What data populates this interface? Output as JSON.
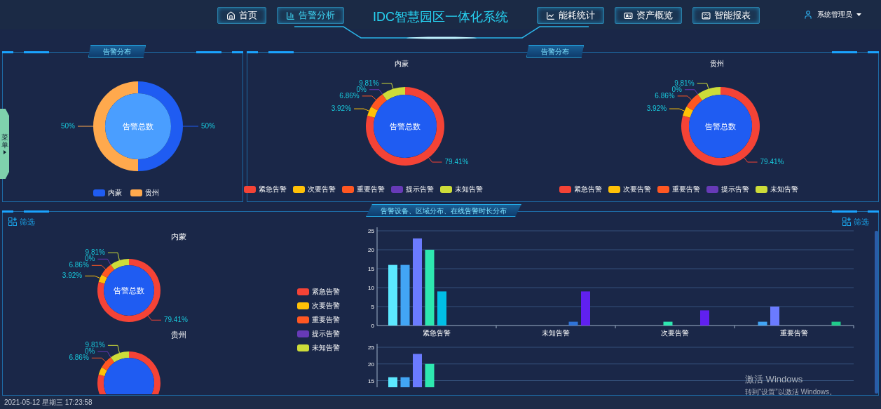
{
  "header": {
    "nav_left": [
      {
        "label": "首页",
        "selected": false
      },
      {
        "label": "告警分析",
        "selected": true
      }
    ],
    "title": "IDC智慧园区一体化系统",
    "nav_right": [
      {
        "label": "能耗统计",
        "selected": false
      },
      {
        "label": "资产概览",
        "selected": false
      },
      {
        "label": "智能报表",
        "selected": false
      }
    ],
    "user": "系统管理员"
  },
  "side_menu": {
    "label": "菜单"
  },
  "region_panel": {
    "title": "告警分布",
    "center_label": "告警总数",
    "chart_data": {
      "type": "donut",
      "values": [
        50,
        50
      ],
      "value_labels": [
        "50%",
        "50%"
      ]
    },
    "legend": [
      {
        "label": "内蒙",
        "color": "#1f5cf2"
      },
      {
        "label": "贵州",
        "color": "#ffa94d"
      }
    ]
  },
  "level_panel": {
    "title": "告警分布",
    "charts": [
      {
        "title": "内蒙",
        "center_label": "告警总数",
        "chart_data": {
          "type": "donut",
          "values": [
            79.41,
            3.92,
            6.86,
            0,
            9.81
          ],
          "value_labels": [
            "79.41%",
            "3.92%",
            "6.86%",
            "0%",
            "9.81%"
          ]
        },
        "legend": [
          {
            "label": "紧急告警",
            "color": "#f44336"
          },
          {
            "label": "次要告警",
            "color": "#ffc107"
          },
          {
            "label": "重要告警",
            "color": "#ff5722"
          },
          {
            "label": "提示告警",
            "color": "#673ab7"
          },
          {
            "label": "未知告警",
            "color": "#cddc39"
          }
        ]
      },
      {
        "title": "贵州",
        "center_label": "告警总数",
        "chart_data": {
          "type": "donut",
          "values": [
            79.41,
            3.92,
            6.86,
            0,
            9.81
          ],
          "value_labels": [
            "79.41%",
            "3.92%",
            "6.86%",
            "0%",
            "9.81%"
          ]
        },
        "legend": [
          {
            "label": "紧急告警",
            "color": "#f44336"
          },
          {
            "label": "次要告警",
            "color": "#ffc107"
          },
          {
            "label": "重要告警",
            "color": "#ff5722"
          },
          {
            "label": "提示告警",
            "color": "#673ab7"
          },
          {
            "label": "未知告警",
            "color": "#cddc39"
          }
        ]
      }
    ]
  },
  "detail_panel": {
    "title": "告警设备、区域分布、在线告警时长分布",
    "filters": [
      "筛选",
      "筛选"
    ],
    "donuts": [
      {
        "title": "内蒙",
        "center_label": "告警总数",
        "chart_data": {
          "type": "donut",
          "values": [
            79.41,
            3.92,
            6.86,
            0,
            9.81
          ],
          "value_labels": [
            "79.41%",
            "3.92%",
            "6.86%",
            "0%",
            "9.81%"
          ]
        }
      },
      {
        "title": "贵州",
        "chart_data": {
          "type": "donut",
          "values": [
            79.41,
            3.92,
            6.86,
            0,
            9.81
          ],
          "value_labels": [
            null,
            null,
            "6.86%",
            "0%",
            "9.81%"
          ]
        }
      }
    ],
    "legend": [
      {
        "label": "紧急告警",
        "color": "#f44336"
      },
      {
        "label": "次要告警",
        "color": "#ffc107"
      },
      {
        "label": "重要告警",
        "color": "#ff5722"
      },
      {
        "label": "提示告警",
        "color": "#673ab7"
      },
      {
        "label": "未知告警",
        "color": "#cddc39"
      }
    ],
    "bar_charts": [
      {
        "chart_data": {
          "type": "bar",
          "categories": [
            "紧急告警",
            "未知告警",
            "次要告警",
            "重要告警"
          ],
          "ylim": [
            0,
            25
          ],
          "yticks": [
            0,
            5,
            10,
            15,
            20,
            25
          ],
          "grid": true,
          "series": [
            {
              "color": "#5ce8ff",
              "values": [
                16,
                0,
                0,
                0
              ]
            },
            {
              "color": "#42a5f5",
              "values": [
                16,
                0,
                0,
                1
              ]
            },
            {
              "color": "#6b7bff",
              "values": [
                23,
                0,
                0,
                5
              ]
            },
            {
              "color": "#2ee8b0",
              "values": [
                20,
                0,
                1,
                0
              ]
            },
            {
              "color": "#00bfe6",
              "values": [
                9,
                0,
                0,
                0
              ]
            },
            {
              "color": "#2f73d8",
              "values": [
                0,
                1,
                0,
                0
              ]
            },
            {
              "color": "#6020f0",
              "values": [
                0,
                9,
                4,
                0
              ]
            },
            {
              "color": "#1fcc8a",
              "values": [
                0,
                0,
                0,
                1
              ]
            }
          ]
        }
      },
      {
        "chart_data": {
          "type": "bar",
          "ylim": [
            13,
            25
          ],
          "yticks": [
            15,
            20,
            25
          ],
          "grid": true,
          "series": [
            {
              "color": "#5ce8ff",
              "values": [
                16
              ]
            },
            {
              "color": "#42a5f5",
              "values": [
                16
              ]
            },
            {
              "color": "#6b7bff",
              "values": [
                23
              ]
            },
            {
              "color": "#2ee8b0",
              "values": [
                20
              ]
            }
          ]
        }
      }
    ]
  },
  "os_notice": {
    "title": "激活 Windows",
    "text": "转到“设置”以激活 Windows。"
  },
  "status_bar": {
    "datetime": "2021-05-12 星期三 17:23:58"
  }
}
